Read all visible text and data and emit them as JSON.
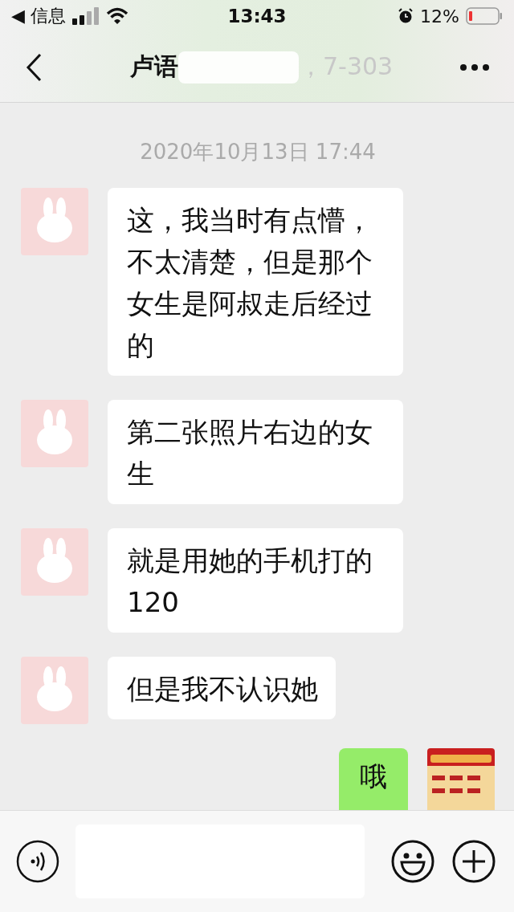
{
  "status_bar": {
    "back_label": "◀ 信息",
    "time": "13:43",
    "battery": "12%"
  },
  "nav": {
    "title_start": "卢语",
    "title_end": "，7-303"
  },
  "timestamp": "2020年10月13日 17:44",
  "messages": [
    {
      "kind": "received",
      "text": "这，我当时有点懵，不太清楚，但是那个女生是阿叔走后经过的"
    },
    {
      "kind": "received",
      "text": "第二张照片右边的女生"
    },
    {
      "kind": "received",
      "text": "就是用她的手机打的120"
    },
    {
      "kind": "received",
      "text": "但是我不认识她"
    },
    {
      "kind": "sent",
      "text": "哦"
    }
  ]
}
